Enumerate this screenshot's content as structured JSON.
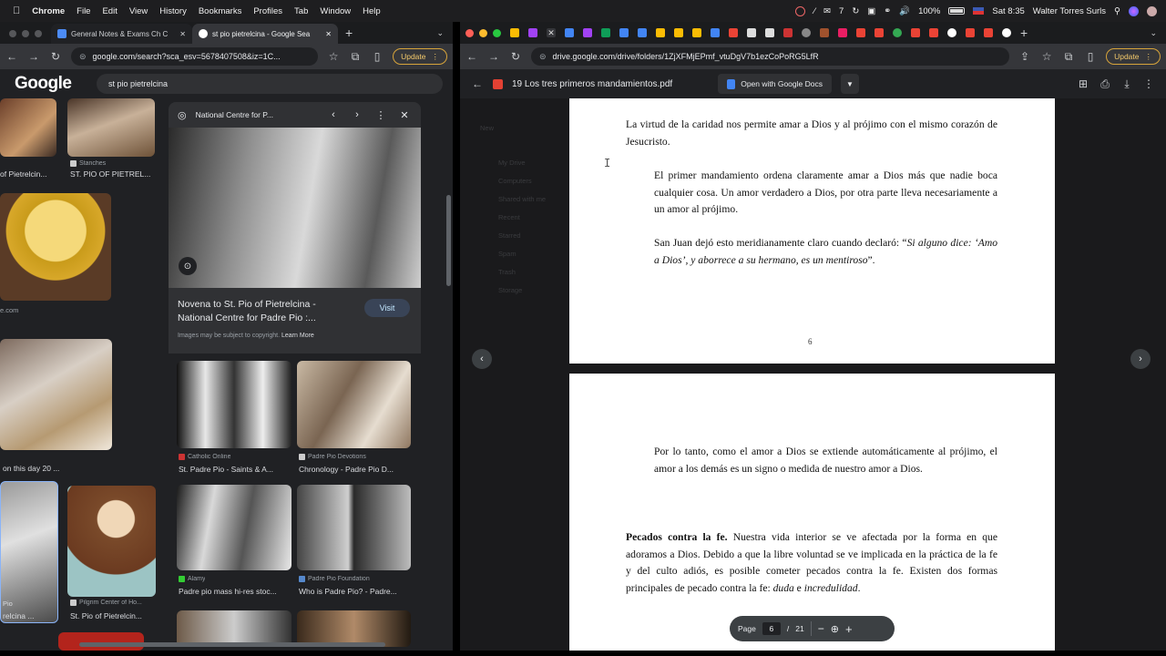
{
  "menubar": {
    "apple": "",
    "items": [
      "Chrome",
      "File",
      "Edit",
      "View",
      "History",
      "Bookmarks",
      "Profiles",
      "Tab",
      "Window",
      "Help"
    ],
    "status_count": "7",
    "battery": "100%",
    "clock": "Sat 8:35",
    "user": "Walter Torres Surls"
  },
  "left": {
    "tabs": [
      {
        "title": "General Notes & Exams Ch C",
        "active": false
      },
      {
        "title": "st pio pietrelcina - Google Sea",
        "active": true
      }
    ],
    "url": "google.com/search?sca_esv=5678407508&iz=1C...",
    "update": "Update",
    "google_logo": "Google",
    "search_query": "st pio pietrelcina",
    "results": [
      {
        "source": "Stanches",
        "caption": "ST. PIO OF PIETREL..."
      },
      {
        "caption": "of Pietrelcin..."
      },
      {
        "caption": "e.com"
      },
      {
        "caption": "on this day 20 ..."
      },
      {
        "caption": "Pio"
      },
      {
        "caption": "relcina ..."
      },
      {
        "source": "Pilgrim Center of Ho...",
        "caption": "St. Pio of Pietrelcin..."
      }
    ],
    "panel": {
      "site": "National Centre for P...",
      "title_line1": "Novena to St. Pio of Pietrelcina -",
      "title_line2": "National Centre for Padre Pio :...",
      "visit": "Visit",
      "copyright": "Images may be subject to copyright.",
      "learn_more": "Learn More"
    },
    "related": [
      {
        "source": "Catholic Online",
        "caption": "St. Padre Pio - Saints & A..."
      },
      {
        "source": "Padre Pio Devotions",
        "caption": "Chronology - Padre Pio D..."
      },
      {
        "source": "Alamy",
        "caption": "Padre pio mass hi-res stoc..."
      },
      {
        "source": "Padre Pio Foundation",
        "caption": "Who is Padre Pio? - Padre..."
      }
    ]
  },
  "right": {
    "url": "drive.google.com/drive/folders/1ZjXFMjEPmf_vtuDgV7b1ezCoPoRG5LfR",
    "update": "Update",
    "file_name": "19 Los tres primeros mandamientos.pdf",
    "open_with": "Open with Google Docs",
    "page1": {
      "p1": "La virtud de la caridad nos permite amar a Dios y al prójimo con el mismo corazón de Jesucristo.",
      "p2": "El primer mandamiento ordena claramente amar a Dios más que nadie boca cualquier cosa. Un amor verdadero a Dios, por otra parte lleva necesariamente a un amor al prójimo.",
      "p3_pre": "San Juan dejó esto meridianamente claro cuando declaró: “",
      "p3_quote": "Si alguno dice: ‘Amo a Dios’, y aborrece a su hermano, es un mentiroso",
      "p3_post": "”.",
      "page_number": "6"
    },
    "page2": {
      "p1": "Por lo tanto, como el amor a Dios se extiende automáticamente al prójimo, el amor a los demás es un signo o medida de nuestro amor a Dios.",
      "p2_heading": "Pecados contra la fe.",
      "p2_body": " Nuestra vida interior se ve afectada por la forma en que adoramos a Dios. Debido a que la libre voluntad se ve implicada en la práctica de la fe y del culto adiós, es posible cometer pecados contra la fe. Existen dos formas principales de pecado contra la fe: ",
      "p2_duda": "duda",
      "p2_e": " e ",
      "p2_incred": "incredulidad",
      "p2_end": "."
    },
    "pagebar": {
      "label": "Page",
      "current": "6",
      "sep": "/",
      "total": "21"
    },
    "bg_ghost": [
      "New",
      "My Drive",
      "Computers",
      "Shared with me",
      "Recent",
      "Starred",
      "Spam",
      "Trash",
      "Storage"
    ]
  },
  "colors": {
    "accent": "#8ab4f8",
    "pdf_red": "#e34133",
    "update": "#f3c96b"
  }
}
